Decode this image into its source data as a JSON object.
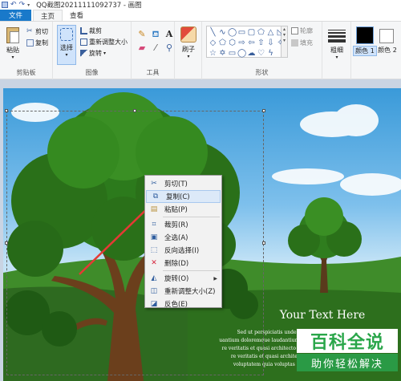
{
  "window": {
    "title": "QQ截图20211111092737 - 画图"
  },
  "tabs": [
    {
      "label": "文件"
    },
    {
      "label": "主页"
    },
    {
      "label": "查看"
    }
  ],
  "ribbon": {
    "clipboard": {
      "paste_label": "粘贴",
      "cut_label": "剪切",
      "copy_label": "复制",
      "group_label": "剪贴板"
    },
    "image": {
      "select_label": "选择",
      "crop_label": "裁剪",
      "resize_label": "重新调整大小",
      "rotate_label": "旋转",
      "group_label": "图像"
    },
    "tools": {
      "group_label": "工具",
      "text_tool_glyph": "A"
    },
    "brush": {
      "label": "刷子"
    },
    "shapes": {
      "outline_label": "轮廓",
      "fill_label": "填充",
      "group_label": "形状"
    },
    "size": {
      "label": "粗细"
    },
    "colors": {
      "color1_label": "颜色 1",
      "color2_label": "颜色 2",
      "color1_value": "#000000",
      "color2_value": "#ffffff"
    }
  },
  "canvas": {
    "text_title": "Your Text Here",
    "text_lines": [
      "Sed ut perspiciatis unde omnis iste",
      "uantium doloremque laudantium, totam",
      "re veritatis et quasi architecto beatae",
      "re veritatis et quasi architecto",
      "voluptatem quia voluptas sit"
    ]
  },
  "context_menu": {
    "items": [
      {
        "label": "剪切(T)",
        "icon": "scissors-icon"
      },
      {
        "label": "复制(C)",
        "icon": "copy-icon"
      },
      {
        "label": "粘贴(P)",
        "icon": "paste-icon"
      },
      {
        "label": "裁剪(R)",
        "icon": "crop-icon"
      },
      {
        "label": "全选(A)",
        "icon": "select-all-icon"
      },
      {
        "label": "反向选择(I)",
        "icon": "invert-selection-icon"
      },
      {
        "label": "删除(D)",
        "icon": "delete-icon"
      },
      {
        "label": "旋转(O)",
        "icon": "rotate-icon"
      },
      {
        "label": "重新调整大小(Z)",
        "icon": "resize-icon"
      },
      {
        "label": "反色(E)",
        "icon": "invert-color-icon"
      }
    ]
  },
  "watermark": {
    "line1": "百科全说",
    "line2": "助你轻松解决"
  },
  "colors": {
    "accent": "#1979ca",
    "arrow": "#e53935",
    "watermark_green": "#2aa64a"
  }
}
